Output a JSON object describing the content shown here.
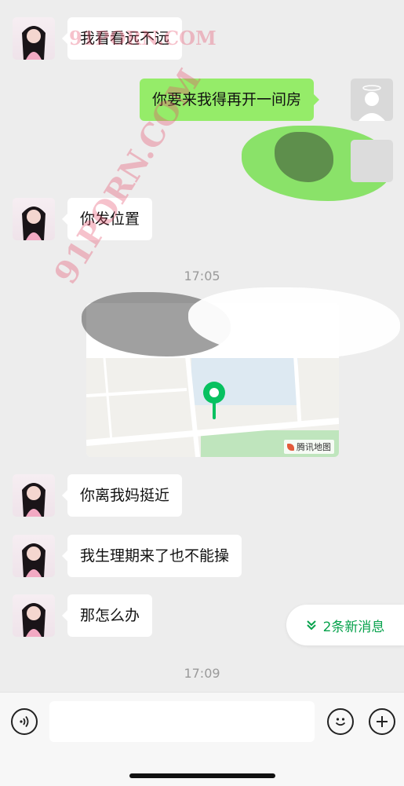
{
  "messages": [
    {
      "text": "我看看远不远"
    },
    {
      "text": "你要来我得再开一间房"
    },
    {
      "text": "你发位置"
    },
    {
      "text": "你离我妈挺近"
    },
    {
      "text": "我生理期来了也不能操"
    },
    {
      "text": "那怎么办"
    }
  ],
  "timestamps": [
    "17:05",
    "17:09"
  ],
  "map": {
    "provider_label": "腾讯地图",
    "pin_color": "#07c160"
  },
  "new_messages_pill": {
    "label": "2条新消息",
    "icon": "double-chevron-down-icon"
  },
  "input_bar": {
    "voice_icon": "voice-icon",
    "emoji_icon": "emoji-icon",
    "plus_icon": "plus-icon",
    "placeholder": ""
  },
  "watermark": {
    "text": "91PORN.COM"
  },
  "colors": {
    "background": "#ededed",
    "my_bubble": "#95ec69",
    "other_bubble": "#ffffff",
    "accent": "#07a24c"
  }
}
